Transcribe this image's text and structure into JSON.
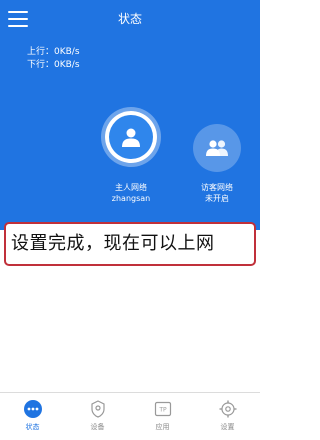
{
  "header": {
    "title": "状态"
  },
  "speed": {
    "upload": "上行：0KB/s",
    "download": "下行：0KB/s"
  },
  "devices": {
    "host": {
      "label": "主人网络",
      "name": "zhangsan"
    },
    "guest": {
      "label": "访客网络",
      "status": "未开启"
    }
  },
  "overlay": {
    "text": "设置完成，现在可以上网"
  },
  "tabs": [
    {
      "label": "状态",
      "icon": "status-dots-icon"
    },
    {
      "label": "设备",
      "icon": "devices-icon"
    },
    {
      "label": "应用",
      "icon": "app-tp-icon"
    },
    {
      "label": "设置",
      "icon": "gear-icon"
    }
  ],
  "colors": {
    "primary": "#2074e1",
    "overlay_border": "#c0303a"
  }
}
